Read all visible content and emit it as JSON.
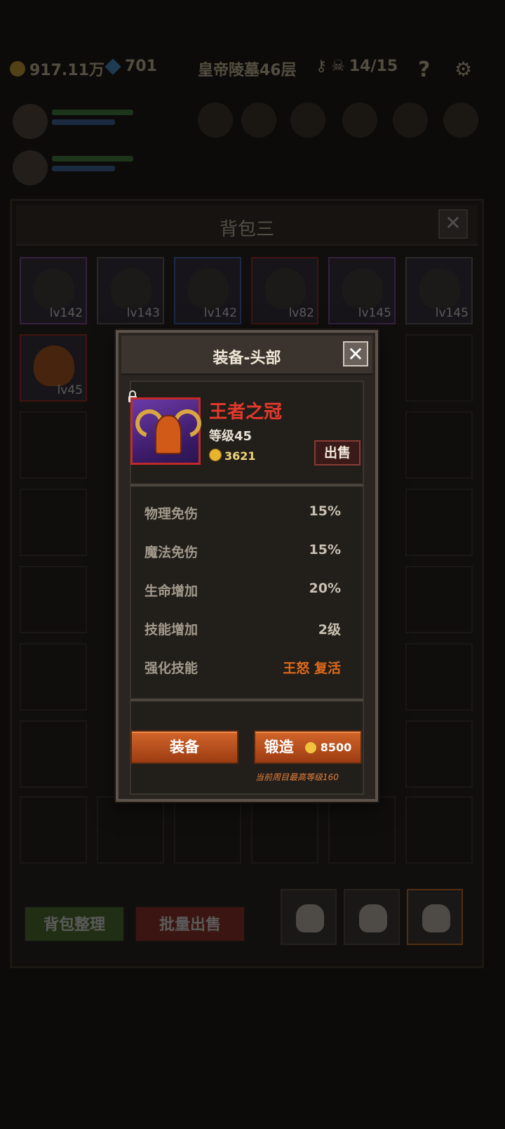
{
  "status_bar": {
    "gold": "917.11万",
    "gems": "701",
    "stage": "皇帝陵墓46层",
    "keys": "14/15",
    "help": "?"
  },
  "bag": {
    "title": "背包三",
    "close": "✕",
    "items": [
      {
        "level": "lv142",
        "rarity": "purple"
      },
      {
        "level": "lv143",
        "rarity": "gray"
      },
      {
        "level": "lv142",
        "rarity": "blue"
      },
      {
        "level": "lv82",
        "rarity": "red"
      },
      {
        "level": "lv145",
        "rarity": "purple"
      },
      {
        "level": "lv145",
        "rarity": "gray"
      },
      {
        "level": "lv45",
        "rarity": "red"
      }
    ],
    "organize_button": "背包整理",
    "bulk_sell_button": "批量出售"
  },
  "modal": {
    "title": "装备-头部",
    "close": "✕",
    "item": {
      "name": "王者之冠",
      "level": "等级45",
      "price": "3621",
      "sell_button": "出售"
    },
    "stats": [
      {
        "label": "物理免伤",
        "value": "15%"
      },
      {
        "label": "魔法免伤",
        "value": "15%"
      },
      {
        "label": "生命增加",
        "value": "20%"
      },
      {
        "label": "技能增加",
        "value": "2级"
      },
      {
        "label": "强化技能",
        "value": "王怒 复活"
      }
    ],
    "equip_button": "装备",
    "forge_button": "锻造",
    "forge_cost": "8500",
    "note": "当前周目最高等级160"
  },
  "colors": {
    "item_name": "#e33a2c",
    "skill": "#e06a1a",
    "button": "#c2541f"
  }
}
